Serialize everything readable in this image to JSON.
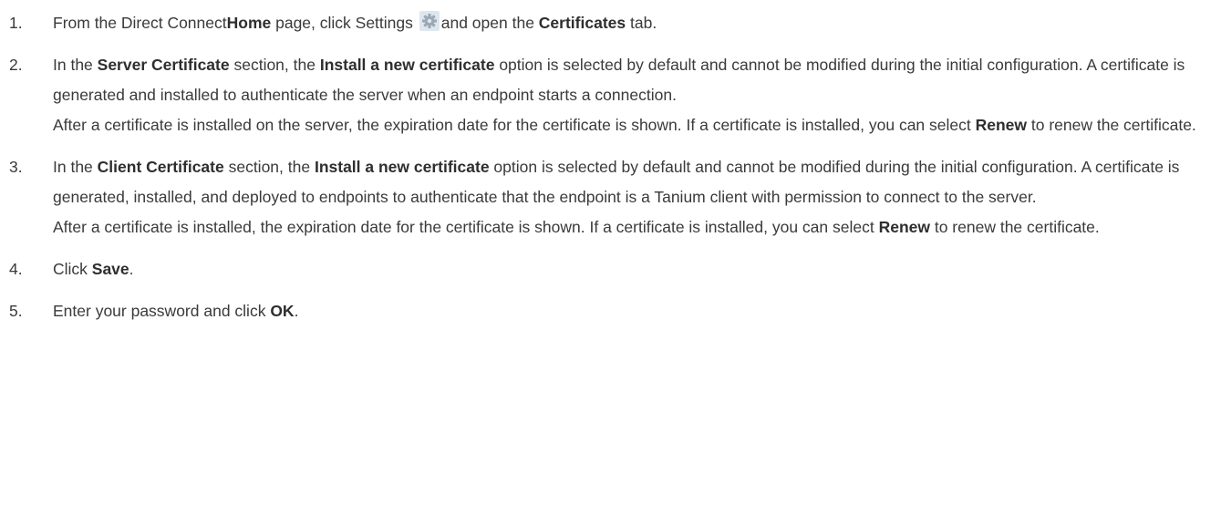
{
  "steps": [
    {
      "num": "1.",
      "t1": "From the Direct Connect",
      "b1": "Home",
      "t2": " page, click Settings ",
      "t3": "and open the ",
      "b2": "Certificates",
      "t4": " tab."
    },
    {
      "num": "2.",
      "t1": "In the ",
      "b1": "Server Certificate",
      "t2": " section, the ",
      "b2": "Install a new certificate",
      "t3": " option is selected by default and cannot be modified during the initial configuration. A certificate is generated and installed to authenticate the server when an endpoint starts a connection.",
      "p2_t1": "After a certificate is installed on the server, the expiration date for the certificate is shown. If a certificate is installed, you can select ",
      "p2_b1": "Renew",
      "p2_t2": " to renew the certificate."
    },
    {
      "num": "3.",
      "t1": "In the ",
      "b1": "Client Certificate",
      "t2": " section, the ",
      "b2": "Install a new certificate",
      "t3": " option is selected by default and cannot be modified during the initial configuration. A certificate is generated, installed, and deployed to endpoints to authenticate that the endpoint is a Tanium client with permission to connect to the server.",
      "p2_t1": "After a certificate is installed, the expiration date for the certificate is shown. If a certificate is installed, you can select ",
      "p2_b1": "Renew",
      "p2_t2": " to renew the certificate."
    },
    {
      "num": "4.",
      "t1": "Click ",
      "b1": "Save",
      "t2": "."
    },
    {
      "num": "5.",
      "t1": "Enter your password and click ",
      "b1": "OK",
      "t2": "."
    }
  ],
  "icons": {
    "settings": "gear-icon"
  }
}
